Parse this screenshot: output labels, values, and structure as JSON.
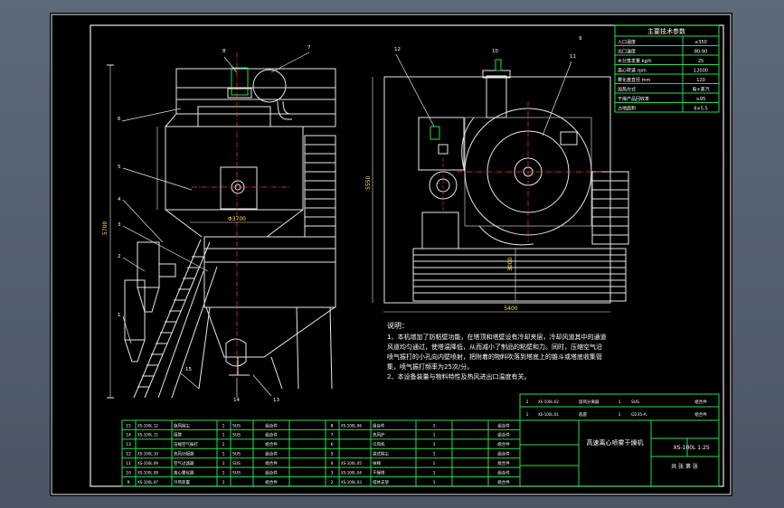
{
  "params_table": {
    "title": "主要技术参数",
    "rows": [
      {
        "label": "入口温度",
        "value": "≤350"
      },
      {
        "label": "出口温度",
        "value": "80-90"
      },
      {
        "label": "水分蒸发量 kg/h",
        "value": "25"
      },
      {
        "label": "离心转速 rpm",
        "value": "12000"
      },
      {
        "label": "雾化盘直径 mm",
        "value": "120"
      },
      {
        "label": "加热方式",
        "value": "电+蒸汽"
      },
      {
        "label": "干燥产品回收率",
        "value": "≥95"
      },
      {
        "label": "占地面积",
        "value": "6×5.5"
      }
    ]
  },
  "notes": {
    "heading": "说明：",
    "lines": [
      "1、本机增加了防粘壁功能，在塔顶和塔壁设有冷却夹层，冷却风道其中的通道",
      "   风道均匀通过，使塔温降低，从而减小了制品的粘壁和力。同时，压缩空气沿",
      "   喷气振打的小孔向内壁喷射，把附着的物料吹落到塔底上的锥斗或塔底收集管",
      "   集，喷气振打频率为25次/分。",
      "2、本设备装量与物料特性及热风进出口温度有关。"
    ]
  },
  "part_labels": [
    "8",
    "7",
    "6",
    "5",
    "4",
    "3",
    "2",
    "1",
    "15",
    "14",
    "13",
    "12",
    "11",
    "10",
    "9"
  ],
  "dimensions": {
    "left_width": "Φ3700",
    "left_height": "5700",
    "plan_width": "5400",
    "plan_height": "5550",
    "base_width": "3000"
  },
  "bom_rows": [
    {
      "no": "15",
      "code": "XS-100L.12",
      "name": "旋风除尘",
      "qty": "1",
      "mat": "SUS",
      "note": ""
    },
    {
      "no": "14",
      "code": "XS-100L.11",
      "name": "接管",
      "qty": "1",
      "mat": "SUS",
      "note": ""
    },
    {
      "no": "13",
      "code": "",
      "name": "压缩空气振打",
      "qty": "1",
      "mat": "",
      "note": ""
    },
    {
      "no": "12",
      "code": "XS-100L.10",
      "name": "热风分配器",
      "qty": "1",
      "mat": "SUS",
      "note": ""
    },
    {
      "no": "11",
      "code": "XS-100L.09",
      "name": "空气过滤器",
      "qty": "1",
      "mat": "SUS",
      "note": ""
    },
    {
      "no": "10",
      "code": "XS-100L.08",
      "name": "离心雾化器",
      "qty": "1",
      "mat": "SUS",
      "note": ""
    },
    {
      "no": "9",
      "code": "XS-100L.07",
      "name": "冷风装置",
      "qty": "1",
      "mat": "",
      "note": ""
    }
  ],
  "bom_rows_mid": [
    {
      "no": "8",
      "code": "XS-100L.06",
      "name": "组合件",
      "qty": "1",
      "mat": "",
      "note": "组合件"
    },
    {
      "no": "7",
      "code": "",
      "name": "热风炉",
      "qty": "1",
      "mat": "",
      "note": "组合件"
    },
    {
      "no": "6",
      "code": "",
      "name": "引风机",
      "qty": "1",
      "mat": "",
      "note": "组合件"
    },
    {
      "no": "5",
      "code": "",
      "name": "袋式除尘",
      "qty": "1",
      "mat": "",
      "note": "组合件"
    },
    {
      "no": "4",
      "code": "XS-100L.05",
      "name": "扶梯",
      "qty": "1",
      "mat": "",
      "note": "组合件"
    },
    {
      "no": "3",
      "code": "XS-100L.04",
      "name": "干燥塔",
      "qty": "1",
      "mat": "",
      "note": "组合件"
    },
    {
      "no": "2",
      "code": "XS-100L.03",
      "name": "塔体支架",
      "qty": "1",
      "mat": "",
      "note": "组合件"
    }
  ],
  "upper_rows": [
    {
      "no": "2",
      "code": "XS-100L.02",
      "name": "旋风分离器",
      "qty": "1",
      "mat": "SUS",
      "note": "组合件"
    },
    {
      "no": "1",
      "code": "XS-100L.01",
      "name": "底座",
      "qty": "1",
      "mat": "Q235-A",
      "note": "组合件"
    }
  ],
  "title_block": {
    "name": "高速离心喷雾干燥机",
    "drawing_no": "XS-100L",
    "scale": "1:25",
    "sheet": "共 张 第 张"
  }
}
